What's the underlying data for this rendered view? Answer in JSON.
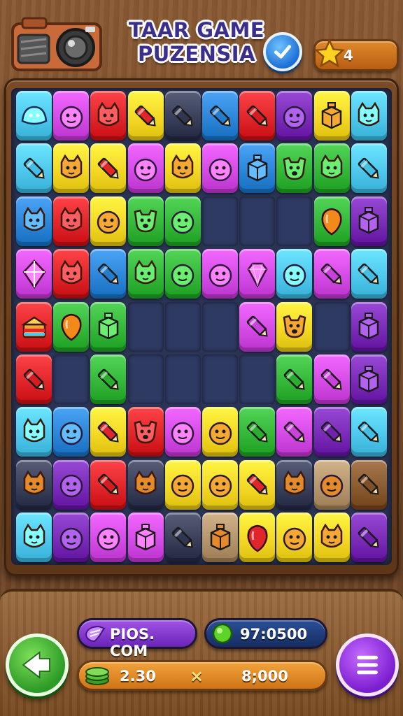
{
  "header": {
    "title_line1": "TAAR GAME",
    "title_line2": "PUZENSIA",
    "icons": [
      "camera-icon",
      "checkmark-icon",
      "star-icon"
    ],
    "star_count": "4"
  },
  "board": {
    "columns": 10,
    "rows": 9,
    "grid": [
      [
        "cyan:blob",
        "magenta:face",
        "red:cat",
        "yellow:crayon",
        "dark:crayon",
        "blue:crayon",
        "red:crayon",
        "purple:face",
        "yellow:box",
        "cyan:cat"
      ],
      [
        "cyan:crayon",
        "yellow:cat",
        "yellow:crayon",
        "magenta:face",
        "yellow:cat",
        "magenta:face",
        "blue:box",
        "green:dog",
        "green:cat",
        "cyan:crayon"
      ],
      [
        "blue:cat",
        "red:cat",
        "yellow:face",
        "green:dog",
        "green:face",
        "empty",
        "empty",
        "empty",
        "green:balloon",
        "purple:box"
      ],
      [
        "magenta:kite",
        "red:cat",
        "blue:crayon",
        "green:cat",
        "green:face",
        "magenta:face",
        "magenta:gem",
        "cyan:face",
        "magenta:crayon",
        "cyan:crayon"
      ],
      [
        "red:cake",
        "green:balloon",
        "green:box",
        "empty",
        "empty",
        "empty",
        "magenta:crayon",
        "yellow:dog",
        "empty",
        "purple:box"
      ],
      [
        "red:crayon",
        "empty",
        "green:crayon",
        "empty",
        "empty",
        "empty",
        "empty",
        "green:crayon",
        "magenta:crayon",
        "purple:box"
      ],
      [
        "cyan:cat",
        "blue:face",
        "yellow:crayon",
        "red:dog",
        "magenta:face",
        "yellow:face",
        "green:crayon",
        "magenta:crayon",
        "purple:crayon",
        "cyan:crayon"
      ],
      [
        "dark:cat",
        "purple:face",
        "red:crayon",
        "dark:cat",
        "yellow:face",
        "yellow:face",
        "yellow:crayon",
        "dark:cat",
        "tan:face",
        "brown:crayon"
      ],
      [
        "cyan:cat",
        "purple:face",
        "magenta:face",
        "magenta:box",
        "dark:crayon",
        "tan:box",
        "yellow:balloon",
        "yellow:face",
        "yellow:cat",
        "purple:crayon"
      ]
    ],
    "colors": {
      "cyan": "#4fc8ee",
      "magenta": "#d54be6",
      "red": "#e0262a",
      "yellow": "#f5d826",
      "dark": "#3a3f5a",
      "blue": "#2e86d8",
      "purple": "#7a2bb8",
      "green": "#35b83a",
      "tan": "#b4956c",
      "brown": "#8a5a30"
    }
  },
  "footer": {
    "site_label": "PIOS. COM",
    "coins_value": "97:0500",
    "cash_left": "2.30",
    "multiply_symbol": "×",
    "cash_right": "8;000",
    "icons": [
      "back-icon",
      "menu-icon",
      "gem-icon",
      "coin-icon",
      "cash-icon"
    ]
  }
}
